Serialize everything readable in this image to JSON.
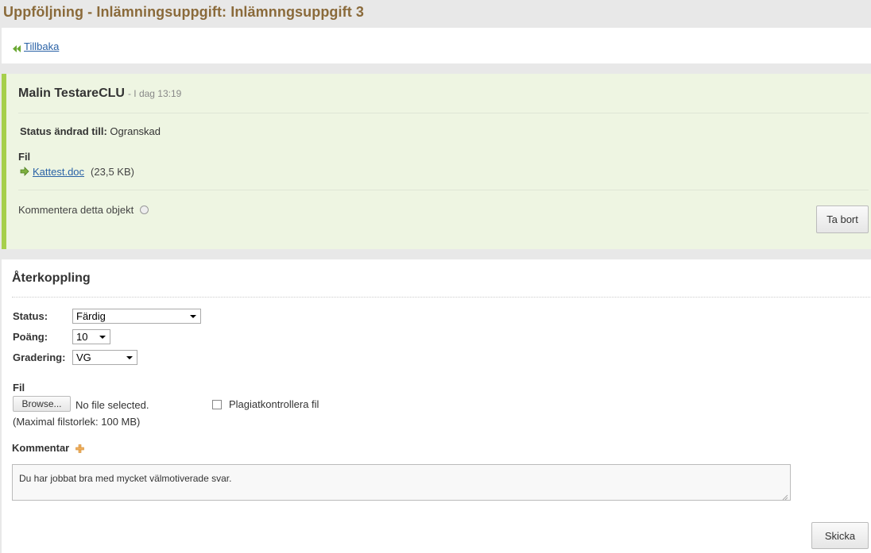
{
  "page": {
    "title": "Uppföljning - Inlämningsuppgift: Inlämnngsuppgift 3"
  },
  "nav": {
    "back_label": "Tillbaka"
  },
  "entry": {
    "author": "Malin TestareCLU",
    "time": "- I dag 13:19",
    "status_label": "Status ändrad till:",
    "status_value": "Ogranskad",
    "file_heading": "Fil",
    "file_name": "Kattest.doc",
    "file_size": "(23,5 KB)",
    "comment_object_label": "Kommentera detta objekt",
    "delete_label": "Ta bort"
  },
  "feedback": {
    "title": "Återkoppling",
    "status_label": "Status:",
    "status_selected": "Färdig",
    "points_label": "Poäng:",
    "points_selected": "10",
    "grading_label": "Gradering:",
    "grading_selected": "VG",
    "file_heading": "Fil",
    "browse_label": "Browse...",
    "no_file_text": "No file selected.",
    "max_size_text": "(Maximal filstorlek: 100 MB)",
    "plagiarism_label": "Plagiatkontrollera fil",
    "comment_label": "Kommentar",
    "comment_value": "Du har jobbat bra med mycket välmotiverade svar.",
    "send_label": "Skicka"
  },
  "colors": {
    "title": "#8a6a3a",
    "link": "#2a62a6",
    "entry_bg": "#eef5e2",
    "entry_accent": "#a6cf4b"
  },
  "icons": {
    "back": "double-left-arrow-icon",
    "download": "download-icon",
    "help": "help-circle-icon",
    "add_comment": "plus-icon"
  }
}
